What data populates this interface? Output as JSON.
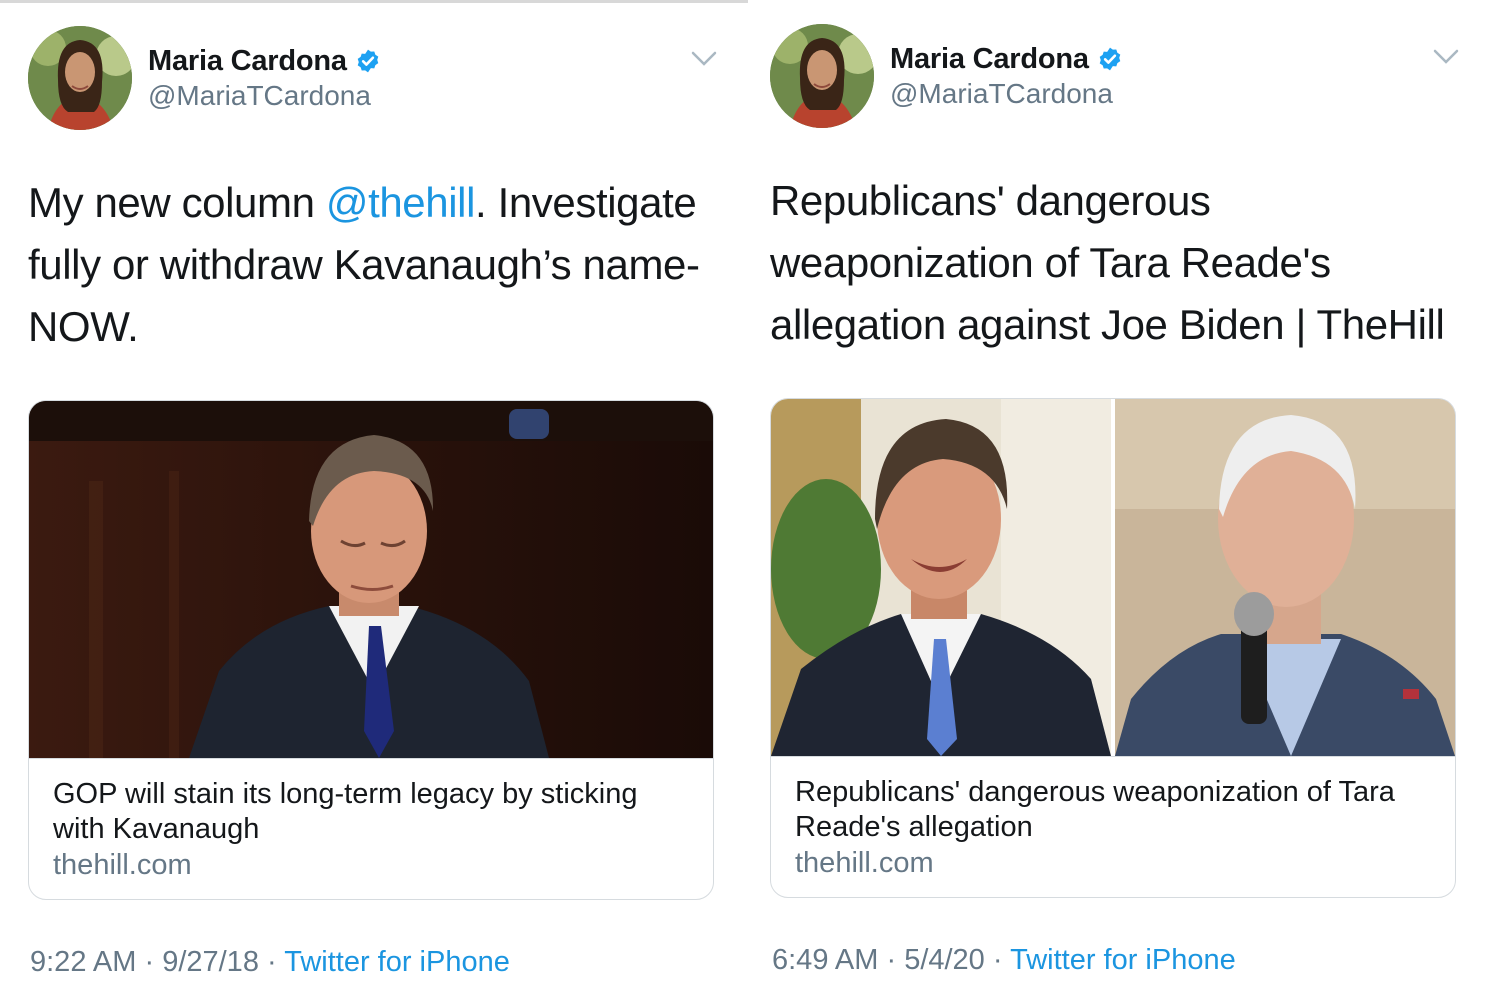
{
  "tweets": [
    {
      "display_name": "Maria Cardona",
      "handle": "@MariaTCardona",
      "text_before": "My new column ",
      "mention": "@thehill",
      "text_after": ". Investigate fully or withdraw Kavanaugh’s name- NOW.",
      "card": {
        "title": "GOP will stain its long-term legacy by sticking with Kavanaugh",
        "domain": "thehill.com"
      },
      "time": "9:22 AM",
      "date": "9/27/18",
      "source": "Twitter for iPhone"
    },
    {
      "display_name": "Maria Cardona",
      "handle": "@MariaTCardona",
      "text_before": "Republicans' dangerous weaponization of Tara Reade's allegation against Joe Biden | TheHill",
      "mention": "",
      "text_after": "",
      "card": {
        "title": "Republicans' dangerous weaponization of Tara Reade's allegation",
        "domain": "thehill.com"
      },
      "time": "6:49 AM",
      "date": "5/4/20",
      "source": "Twitter for iPhone"
    }
  ],
  "meta_separator": " · ",
  "colors": {
    "link": "#1b95e0",
    "secondary": "#657786",
    "verified": "#1da1f2"
  }
}
